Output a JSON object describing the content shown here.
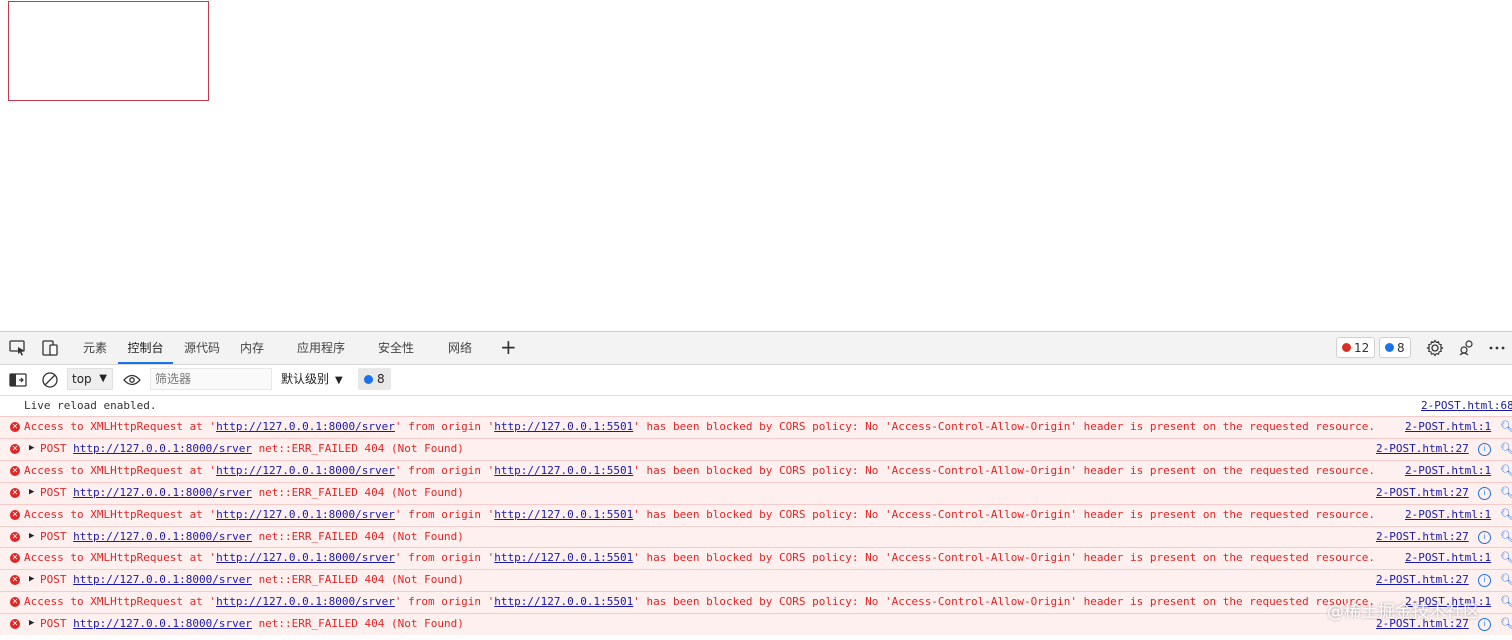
{
  "tabbar": {
    "tabs": [
      {
        "label": "元素"
      },
      {
        "label": "控制台"
      },
      {
        "label": "源代码"
      },
      {
        "label": "内存"
      },
      {
        "label": "应用程序"
      },
      {
        "label": "安全性"
      },
      {
        "label": "网络"
      }
    ],
    "active_tab": "控制台",
    "error_count": "12",
    "message_count": "8"
  },
  "toolbar": {
    "context": "top",
    "filter_placeholder": "筛选器",
    "level_label": "默认级别",
    "message_badge": "8"
  },
  "console": {
    "info_text": "Live reload enabled.",
    "info_source": "2-POST.html:68",
    "cors": {
      "part1": "Access to XMLHttpRequest at '",
      "url": "http://127.0.0.1:8000/srver",
      "part2": "' from origin '",
      "origin": "http://127.0.0.1:5501",
      "part3": "' has been blocked by CORS policy: No 'Access-Control-Allow-Origin' header is present on the requested resource.",
      "source": "2-POST.html:1"
    },
    "post": {
      "method": "POST",
      "url": "http://127.0.0.1:8000/srver",
      "status": "net::ERR_FAILED 404 (Not Found)",
      "source": "2-POST.html:27"
    }
  },
  "watermark": "@稀土掘金技术社区",
  "colors": {
    "error_red": "#e02525",
    "error_bg": "#fff0f0",
    "accent_blue": "#1a73e8",
    "link_blue": "#1a1aa6",
    "highlight_box": "#c3394f"
  }
}
